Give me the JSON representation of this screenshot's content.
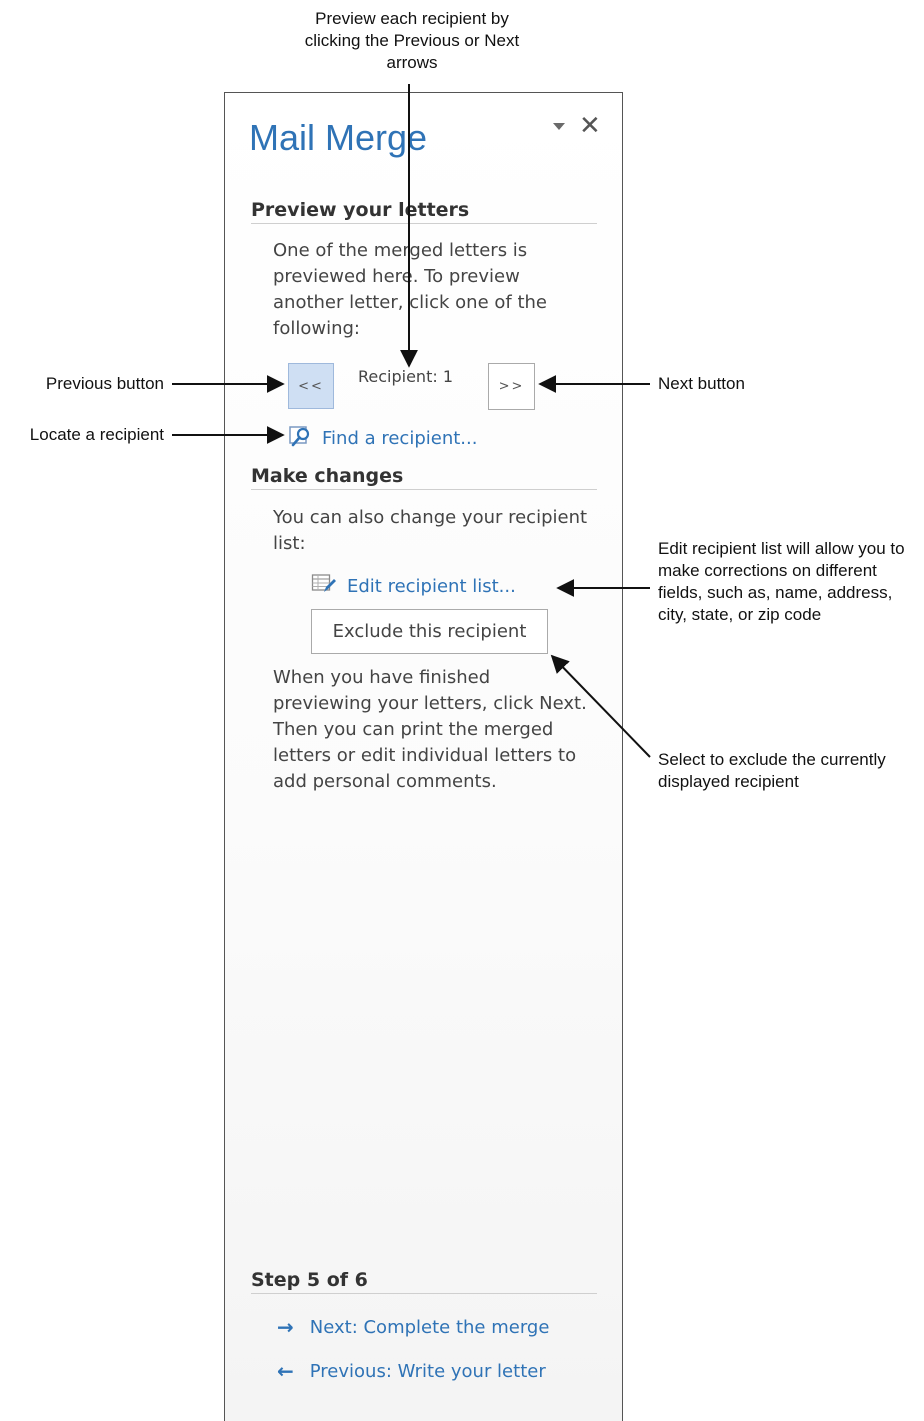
{
  "callouts": {
    "top": "Preview each recipient by clicking the Previous or Next arrows",
    "previous": "Previous button",
    "locate": "Locate a recipient",
    "next": "Next button",
    "edit": "Edit recipient list will allow you to make corrections on different fields, such as, name, address, city, state, or zip code",
    "exclude": "Select to exclude the currently displayed recipient"
  },
  "pane": {
    "title": "Mail Merge",
    "dropdown_icon": "chevron-down-icon",
    "close_icon": "close-icon",
    "close_glyph": "✕",
    "preview": {
      "heading": "Preview your letters",
      "text": "One of the merged letters is previewed here. To preview another letter, click one of the following:",
      "prev_label": "<<",
      "recipient": "Recipient: 1",
      "next_label": ">>",
      "find_label": "Find a recipient..."
    },
    "changes": {
      "heading": "Make changes",
      "text": "You can also change your recipient list:",
      "edit_label": "Edit recipient list...",
      "exclude_label": "Exclude this recipient",
      "finish_text": "When you have finished previewing your letters, click Next. Then you can print the merged letters or edit individual letters to add personal comments."
    },
    "step": {
      "heading": "Step 5 of 6",
      "next_label": "Next: Complete the merge",
      "next_arrow": "→",
      "previous_label": "Previous: Write your letter",
      "previous_arrow": "←"
    }
  }
}
